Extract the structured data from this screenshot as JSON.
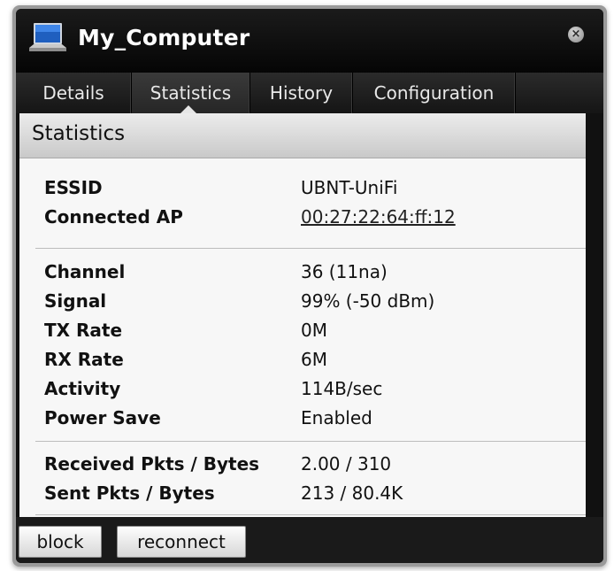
{
  "window": {
    "title": "My_Computer",
    "close_glyph": "×",
    "icon": "laptop-icon"
  },
  "tabs": [
    {
      "label": "Details",
      "active": false
    },
    {
      "label": "Statistics",
      "active": true
    },
    {
      "label": "History",
      "active": false
    },
    {
      "label": "Configuration",
      "active": false
    }
  ],
  "section": {
    "title": "Statistics"
  },
  "stats": {
    "group1": [
      {
        "label": "ESSID",
        "value": "UBNT-UniFi"
      },
      {
        "label": "Connected AP",
        "value": "00:27:22:64:ff:12"
      }
    ],
    "group2": [
      {
        "label": "Channel",
        "value": "36 (11na)"
      },
      {
        "label": "Signal",
        "value": "99% (-50 dBm)"
      },
      {
        "label": "TX Rate",
        "value": "0M"
      },
      {
        "label": "RX Rate",
        "value": "6M"
      },
      {
        "label": "Activity",
        "value": "114B/sec"
      },
      {
        "label": "Power Save",
        "value": "Enabled"
      }
    ],
    "group3": [
      {
        "label": "Received Pkts / Bytes",
        "value": "2.00 / 310"
      },
      {
        "label": "Sent Pkts / Bytes",
        "value": "213 / 80.4K"
      }
    ]
  },
  "buttons": {
    "block": "block",
    "reconnect": "reconnect"
  }
}
